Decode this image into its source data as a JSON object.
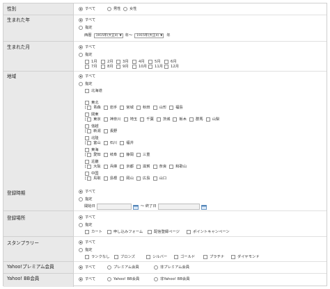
{
  "labels": {
    "gender": "性別",
    "birth_year": "生まれた年",
    "birth_month": "生まれた月",
    "region": "地域",
    "reg_time": "登録時期",
    "reg_place": "登録場所",
    "stamp_rally": "スタンプラリー",
    "premium": "Yahoo!プレミアム会員",
    "bb": "Yahoo! BB会員"
  },
  "common": {
    "all": "すべて",
    "specify": "指定",
    "bracket": "["
  },
  "gender": {
    "options": [
      "すべて",
      "男性",
      "女性"
    ]
  },
  "birth_year": {
    "era": "西暦",
    "from_value": "1915年(大正4)",
    "to_value": "1915年(大正4)",
    "tilde_year": "年～",
    "year": "年"
  },
  "months": [
    "1月",
    "2月",
    "3月",
    "4月",
    "5月",
    "6月",
    "7月",
    "8月",
    "9月",
    "10月",
    "11月",
    "12月"
  ],
  "regions": [
    {
      "name": "北海道",
      "prefs": []
    },
    {
      "name": "東北",
      "prefs": [
        "青森",
        "岩手",
        "宮城",
        "秋田",
        "山形",
        "福島"
      ]
    },
    {
      "name": "関東",
      "prefs": [
        "東京",
        "神奈川",
        "埼玉",
        "千葉",
        "茨城",
        "栃木",
        "群馬",
        "山梨"
      ]
    },
    {
      "name": "信越",
      "prefs": [
        "新潟",
        "長野"
      ]
    },
    {
      "name": "北陸",
      "prefs": [
        "富山",
        "石川",
        "福井"
      ]
    },
    {
      "name": "東海",
      "prefs": [
        "愛知",
        "岐阜",
        "静岡",
        "三重"
      ]
    },
    {
      "name": "近畿",
      "prefs": [
        "大阪",
        "兵庫",
        "京都",
        "滋賀",
        "奈良",
        "和歌山"
      ]
    },
    {
      "name": "中国",
      "prefs": [
        "鳥取",
        "島根",
        "岡山",
        "広島",
        "山口"
      ]
    }
  ],
  "reg_time": {
    "start": "開始日",
    "end": "～ 終了日"
  },
  "reg_place": {
    "options": [
      "カート",
      "申し込みフォーム",
      "配信登録ページ",
      "ポイントキャンペーン"
    ]
  },
  "stamp": {
    "options": [
      "ランクなし",
      "ブロンズ",
      "シルバー",
      "ゴールド",
      "プラチナ",
      "ダイヤモンド"
    ]
  },
  "premium": {
    "options": [
      "すべて",
      "プレミアム会員",
      "非プレミアム会員"
    ]
  },
  "bb": {
    "options": [
      "すべて",
      "Yahoo! BB会員",
      "非Yahoo! BB会員"
    ]
  }
}
